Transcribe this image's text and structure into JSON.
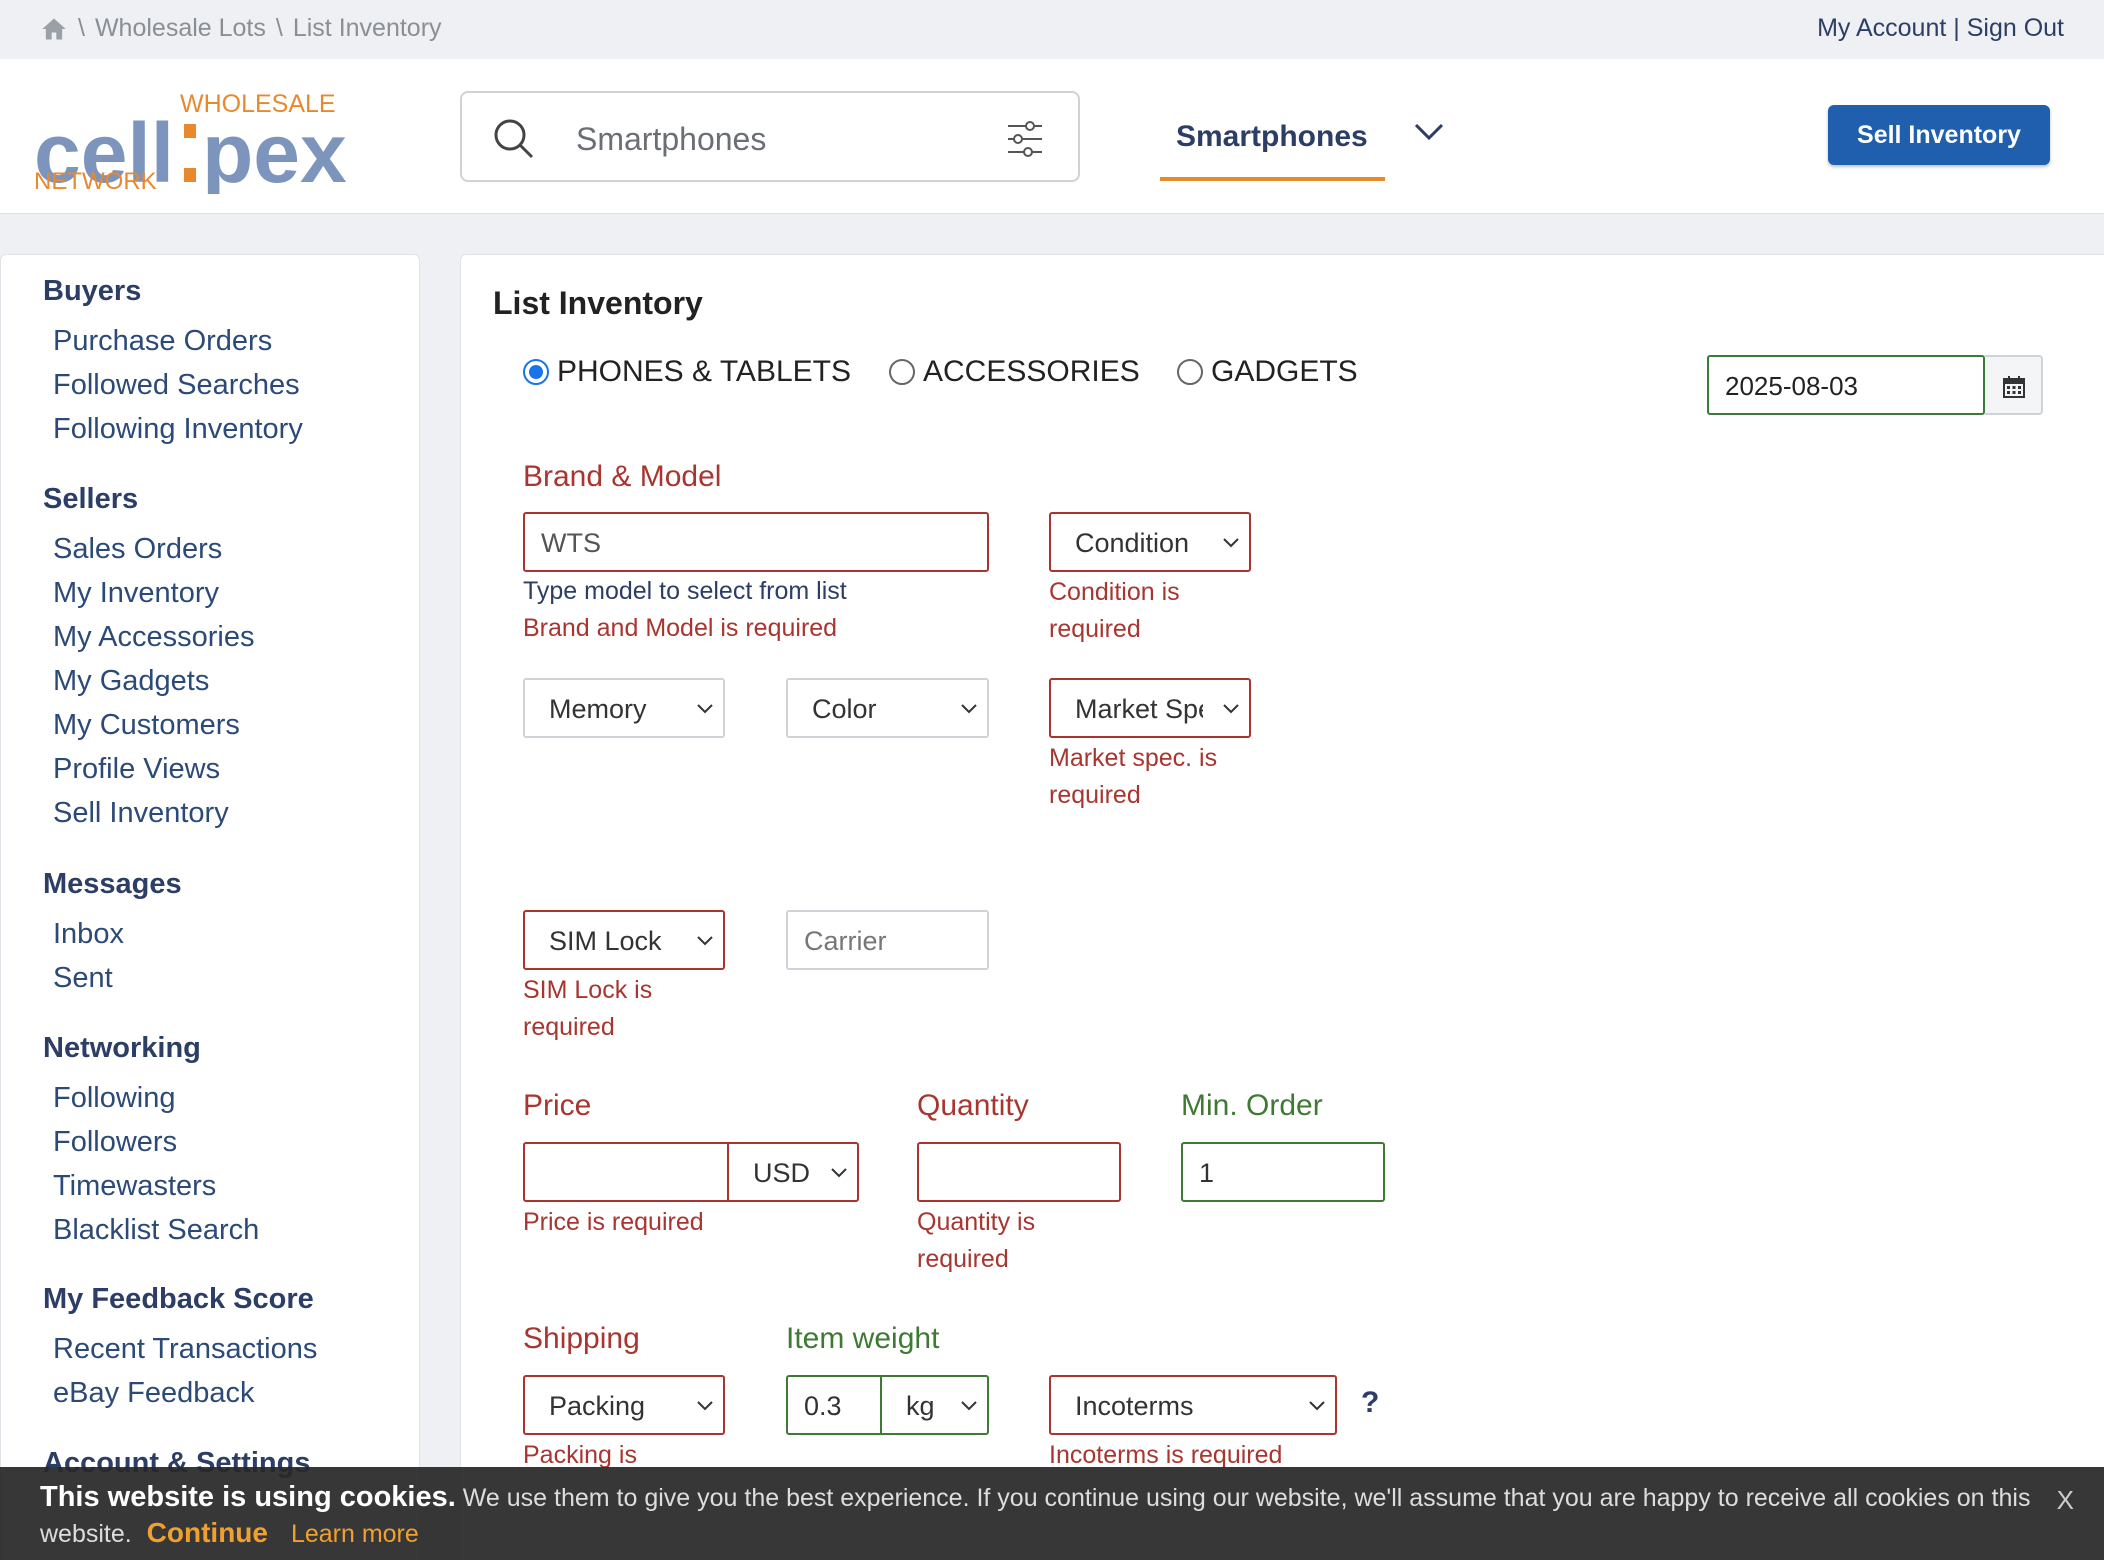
{
  "breadcrumb": {
    "items": [
      "Wholesale Lots",
      "List Inventory"
    ],
    "separator": "\\"
  },
  "account": {
    "my_account": "My Account",
    "divider": "|",
    "sign_out": "Sign Out"
  },
  "logo": {
    "part1": "cell",
    "part2": "pex",
    "top": "WHOLESALE",
    "bottom": "NETWORK"
  },
  "search": {
    "value": "Smartphones"
  },
  "category": {
    "selected": "Smartphones"
  },
  "header": {
    "sell_label": "Sell Inventory"
  },
  "sidebar": {
    "groups": [
      {
        "title": "Buyers",
        "items": [
          "Purchase Orders",
          "Followed Searches",
          "Following Inventory"
        ]
      },
      {
        "title": "Sellers",
        "items": [
          "Sales Orders",
          "My Inventory",
          "My Accessories",
          "My Gadgets",
          "My Customers",
          "Profile Views",
          "Sell Inventory"
        ]
      },
      {
        "title": "Messages",
        "items": [
          "Inbox",
          "Sent"
        ]
      },
      {
        "title": "Networking",
        "items": [
          "Following",
          "Followers",
          "Timewasters",
          "Blacklist Search"
        ]
      },
      {
        "title": "My Feedback Score",
        "items": [
          "Recent Transactions",
          "eBay Feedback"
        ]
      },
      {
        "title": "Account & Settings",
        "items": []
      }
    ]
  },
  "form": {
    "title": "List Inventory",
    "categories": {
      "phones": "PHONES & TABLETS",
      "accessories": "ACCESSORIES",
      "gadgets": "GADGETS",
      "selected": "phones"
    },
    "date": "2025-08-03",
    "brand_model": {
      "label": "Brand & Model",
      "value": "WTS",
      "hint": "Type model to select from list",
      "error": "Brand and Model is required"
    },
    "condition": {
      "value": "Condition",
      "error1": "Condition is",
      "error2": "required"
    },
    "memory": {
      "value": "Memory"
    },
    "color": {
      "value": "Color"
    },
    "market_spec": {
      "value": "Market Spec",
      "error1": "Market spec. is",
      "error2": "required"
    },
    "sim_lock": {
      "value": "SIM Lock",
      "error1": "SIM Lock is",
      "error2": "required"
    },
    "carrier": {
      "placeholder": "Carrier"
    },
    "price": {
      "label": "Price",
      "value": "",
      "currency": "USD",
      "error": "Price is required"
    },
    "quantity": {
      "label": "Quantity",
      "value": "",
      "error1": "Quantity is",
      "error2": "required"
    },
    "min_order": {
      "label": "Min. Order",
      "value": "1"
    },
    "shipping": {
      "label": "Shipping",
      "packing": "Packing",
      "error1": "Packing is"
    },
    "item_weight": {
      "label": "Item weight",
      "value": "0.3",
      "unit": "kg"
    },
    "incoterms": {
      "value": "Incoterms",
      "error": "Incoterms is required",
      "help": "?"
    }
  },
  "cookie": {
    "title": "This website is using cookies.",
    "text1": "We use them to give you the best experience. If you continue using our website, we'll assume that you are happy to receive all cookies on this",
    "text2": "website.",
    "continue": "Continue",
    "learn": "Learn more",
    "close": "X"
  },
  "colors": {
    "brand_blue": "#1f5fae",
    "accent_orange": "#e8892e",
    "error_red": "#a8352f",
    "valid_green": "#3f7a35",
    "nav_navy": "#2c3e66"
  }
}
